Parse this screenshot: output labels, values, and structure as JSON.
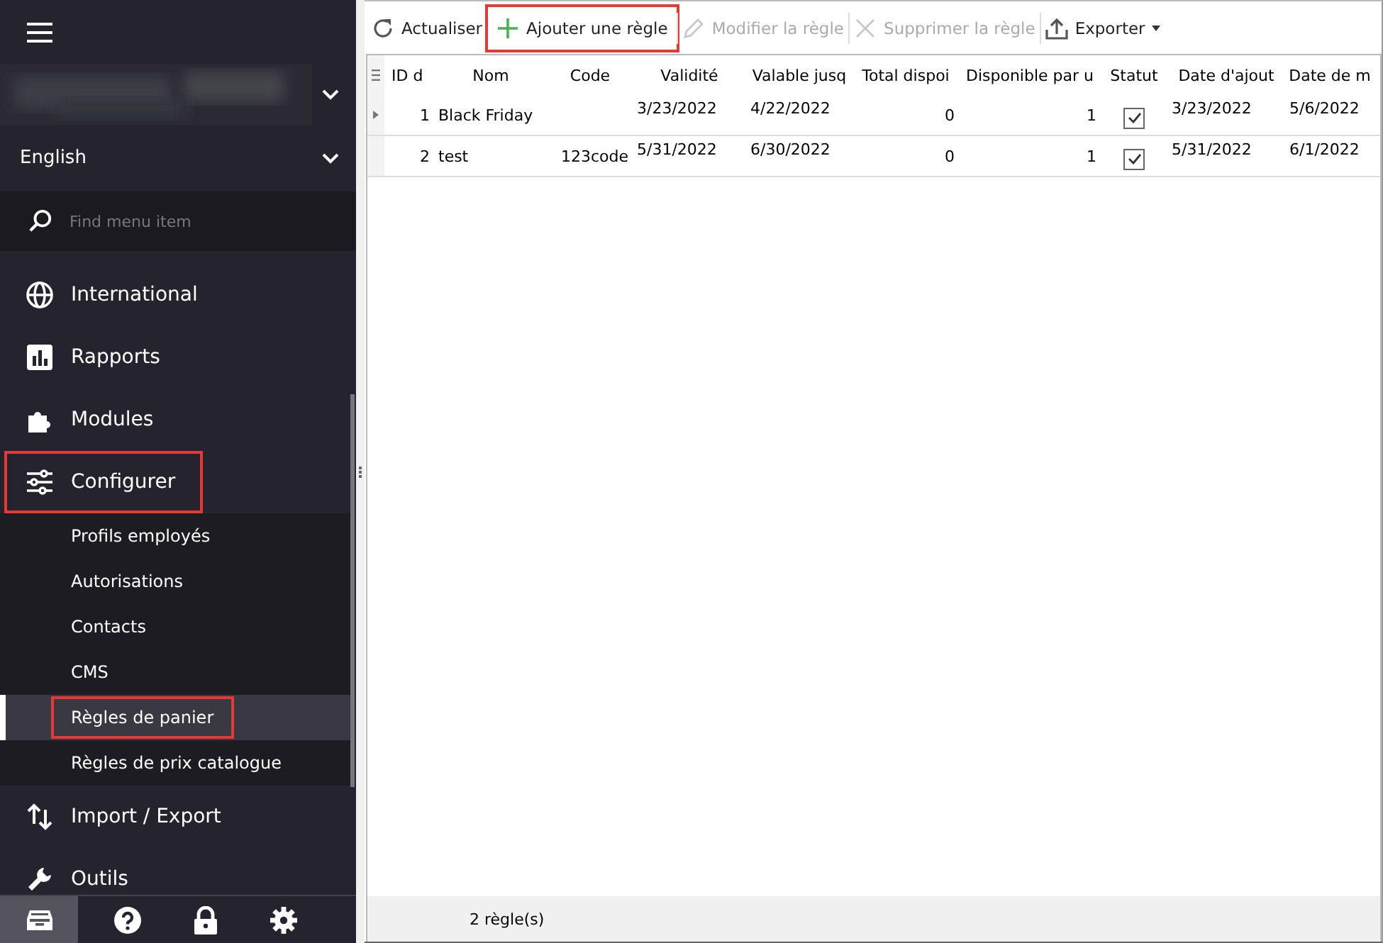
{
  "sidebar": {
    "language": "English",
    "search": {
      "placeholder": "Find menu item"
    },
    "items": [
      {
        "label": "International",
        "highlighted": false
      },
      {
        "label": "Rapports",
        "highlighted": false
      },
      {
        "label": "Modules",
        "highlighted": false
      },
      {
        "label": "Configurer",
        "highlighted": true,
        "children": [
          {
            "label": "Profils employés",
            "selected": false,
            "highlighted": false
          },
          {
            "label": "Autorisations",
            "selected": false,
            "highlighted": false
          },
          {
            "label": "Contacts",
            "selected": false,
            "highlighted": false
          },
          {
            "label": "CMS",
            "selected": false,
            "highlighted": false
          },
          {
            "label": "Règles de panier",
            "selected": true,
            "highlighted": true
          },
          {
            "label": "Règles de prix catalogue",
            "selected": false,
            "highlighted": false
          }
        ]
      },
      {
        "label": "Import / Export",
        "highlighted": false
      },
      {
        "label": "Outils",
        "highlighted": false
      }
    ],
    "bottom_bar": [
      {
        "selected": true
      },
      {
        "selected": false
      },
      {
        "selected": false
      },
      {
        "selected": false
      }
    ]
  },
  "toolbar": [
    {
      "label": "Actualiser",
      "disabled": false,
      "highlighted": false,
      "dropdown": false
    },
    {
      "label": "Ajouter une règle",
      "disabled": false,
      "highlighted": true,
      "dropdown": false
    },
    {
      "label": "Modifier la règle",
      "disabled": true,
      "highlighted": false,
      "dropdown": false
    },
    {
      "label": "Supprimer la règle",
      "disabled": true,
      "highlighted": false,
      "dropdown": false
    },
    {
      "label": "Exporter",
      "disabled": false,
      "highlighted": false,
      "dropdown": true
    }
  ],
  "table": {
    "columns": [
      "ID d",
      "Nom",
      "Code",
      "Validité",
      "Valable jusq",
      "Total dispoi",
      "Disponible par u",
      "Statut",
      "Date d'ajout",
      "Date de m"
    ],
    "rows": [
      {
        "current": true,
        "id": "1",
        "name": "Black Friday",
        "valid_from": "3/23/2022",
        "valid_to": "4/22/2022",
        "total": "0",
        "per_user": "1",
        "status": true,
        "added": "3/23/2022",
        "modified": "5/6/2022"
      },
      {
        "current": false,
        "id": "2",
        "name": "test",
        "code": "123code",
        "valid_from": "5/31/2022",
        "valid_to": "6/30/2022",
        "total": "0",
        "per_user": "1",
        "status": true,
        "added": "5/31/2022",
        "modified": "6/1/2022"
      }
    ]
  },
  "status_bar": "2 règle(s)"
}
